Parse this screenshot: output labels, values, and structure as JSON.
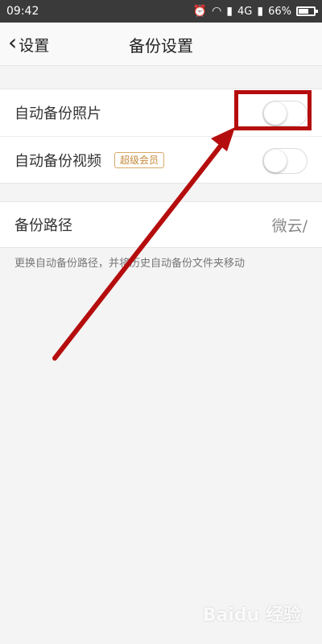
{
  "status": {
    "time": "09:42",
    "network": "4G",
    "battery": "66%",
    "battery_level": 0.66
  },
  "nav": {
    "back_label": "设置",
    "title": "备份设置"
  },
  "settings": {
    "photo_backup_label": "自动备份照片",
    "video_backup_label": "自动备份视频",
    "video_badge": "超级会员",
    "path_label": "备份路径",
    "path_value": "微云/",
    "hint": "更换自动备份路径，并将历史自动备份文件夹移动"
  },
  "watermark": "Baidu 经验",
  "colors": {
    "annotation": "#b50d0d",
    "badge": "#c58a3b"
  }
}
